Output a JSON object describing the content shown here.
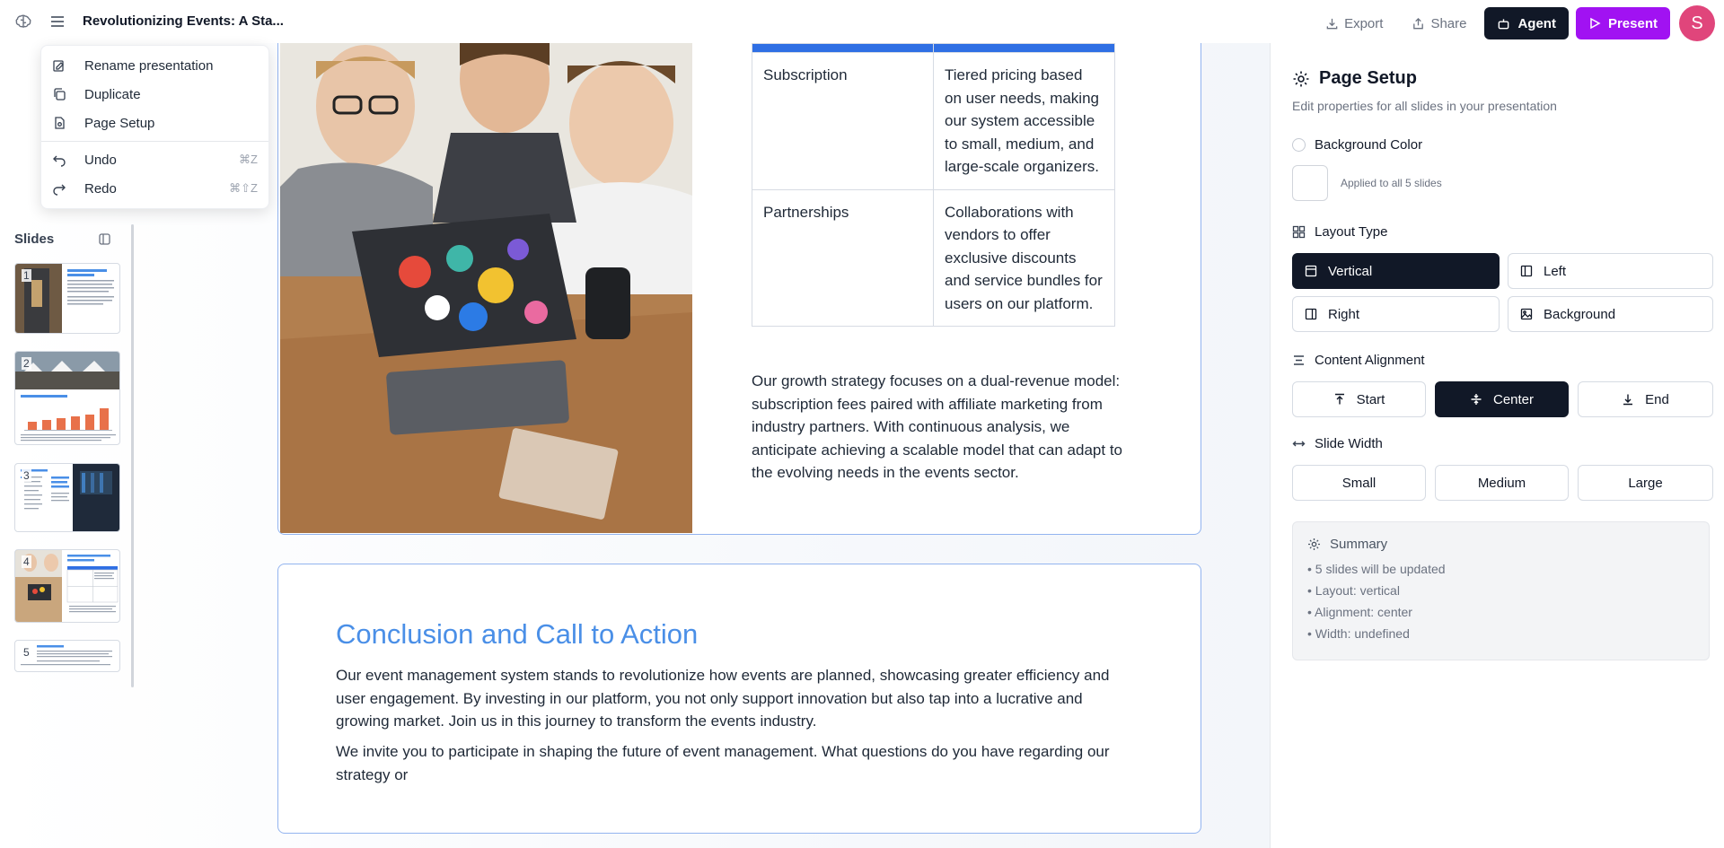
{
  "header": {
    "doc_title": "Revolutionizing Events: A Sta...",
    "export_label": "Export",
    "share_label": "Share",
    "agent_label": "Agent",
    "present_label": "Present",
    "avatar_initial": "S"
  },
  "menu": {
    "items": [
      {
        "label": "Rename presentation",
        "icon": "rename-icon"
      },
      {
        "label": "Duplicate",
        "icon": "duplicate-icon"
      },
      {
        "label": "Page Setup",
        "icon": "page-setup-icon"
      },
      {
        "label": "Undo",
        "icon": "undo-icon",
        "shortcut": "⌘Z"
      },
      {
        "label": "Redo",
        "icon": "redo-icon",
        "shortcut": "⌘⇧Z"
      }
    ]
  },
  "slides_panel": {
    "title": "Slides",
    "thumbnails": [
      {
        "number": "1",
        "title": "Introduction to Our Event Management System"
      },
      {
        "number": "2",
        "title": "Market Analysis and Opportunities"
      },
      {
        "number": "3",
        "title": "Product Overview"
      },
      {
        "number": "4",
        "title": "Business Model and Revenue Streams"
      },
      {
        "number": "5",
        "title": "Conclusion and Call to Action"
      }
    ]
  },
  "slide4": {
    "table_rows": [
      {
        "name": "Subscription",
        "desc": "Tiered pricing based on user needs, making our system accessible to small, medium, and large-scale organizers."
      },
      {
        "name": "Partnerships",
        "desc": "Collaborations with vendors to offer exclusive discounts and service bundles for users on our platform."
      }
    ],
    "paragraph": "Our growth strategy focuses on a dual-revenue model: subscription fees paired with affiliate marketing from industry partners. With continuous analysis, we anticipate achieving a scalable model that can adapt to the evolving needs in the events sector."
  },
  "slide5": {
    "title": "Conclusion and Call to Action",
    "paragraph1": "Our event management system stands to revolutionize how events are planned, showcasing greater efficiency and user engagement. By investing in our platform, you not only support innovation but also tap into a lucrative and growing market. Join us in this journey to transform the events industry.",
    "paragraph2": "We invite you to participate in shaping the future of event management. What questions do you have regarding our strategy or"
  },
  "page_setup": {
    "title": "Page Setup",
    "subtitle": "Edit properties for all slides in your presentation",
    "background_color_label": "Background Color",
    "background_note": "Applied to all 5 slides",
    "layout_type_label": "Layout Type",
    "layout_options": [
      "Vertical",
      "Left",
      "Right",
      "Background"
    ],
    "layout_selected": "Vertical",
    "alignment_label": "Content Alignment",
    "alignment_options": [
      "Start",
      "Center",
      "End"
    ],
    "alignment_selected": "Center",
    "width_label": "Slide Width",
    "width_options": [
      "Small",
      "Medium",
      "Large"
    ],
    "summary_title": "Summary",
    "summary_lines": [
      "• 5 slides will be updated",
      "• Layout: vertical",
      "• Alignment: center",
      "• Width: undefined"
    ]
  },
  "colors": {
    "accent_blue": "#2f6fe4",
    "title_blue": "#4a8fe7",
    "present_purple": "#a112f2",
    "avatar_pink": "#e0457b",
    "selected_dark": "#111827"
  }
}
